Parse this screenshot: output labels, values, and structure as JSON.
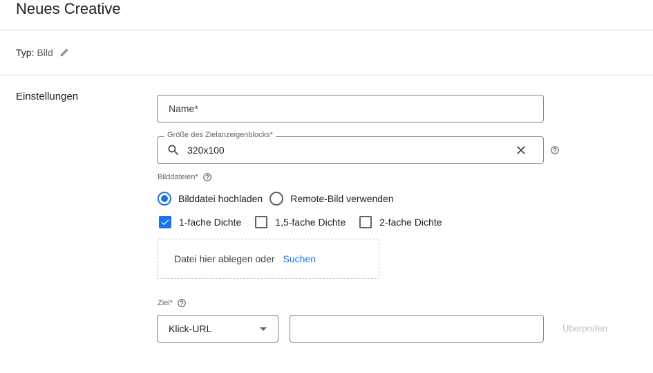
{
  "header": {
    "title": "Neues Creative"
  },
  "type_row": {
    "label": "Typ:",
    "value": "Bild",
    "edit_icon": "pencil-icon"
  },
  "settings": {
    "section_title": "Einstellungen",
    "name_field": {
      "placeholder": "Name*",
      "value": ""
    },
    "size_field": {
      "label": "Größe des Zielanzeigenblocks*",
      "value": "320x100",
      "icons": [
        "search-icon",
        "close-icon",
        "help-icon"
      ]
    },
    "image_files": {
      "label": "Bilddateien*",
      "radios": [
        {
          "label": "Bilddatei hochladen",
          "checked": true
        },
        {
          "label": "Remote-Bild verwenden",
          "checked": false
        }
      ],
      "checkboxes": [
        {
          "label": "1-fache Dichte",
          "checked": true
        },
        {
          "label": "1,5-fache Dichte",
          "checked": false
        },
        {
          "label": "2-fache Dichte",
          "checked": false
        }
      ],
      "dropzone": {
        "text": "Datei hier ablegen oder",
        "link": "Suchen"
      }
    },
    "target": {
      "label": "Ziel*",
      "select_value": "Klick-URL",
      "url_value": "",
      "verify_button": "Überprüfen"
    }
  },
  "colors": {
    "accent": "#1a73e8",
    "disabled_text": "#bdc1c6",
    "border": "#80868b"
  }
}
